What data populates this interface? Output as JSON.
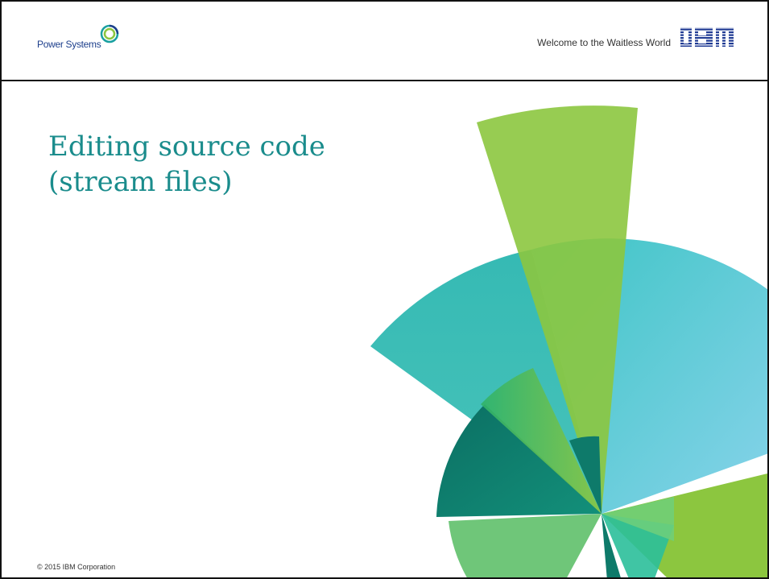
{
  "header": {
    "brand_name": "Power Systems",
    "tagline": "Welcome to the Waitless World",
    "company_logo_icon": "ibm-logo-icon",
    "brand_logo_icon": "power-systems-logo-icon"
  },
  "title": {
    "line1": "Editing source code",
    "line2": "(stream files)"
  },
  "footer": {
    "copyright": "© 2015 IBM Corporation"
  },
  "colors": {
    "title": "#1a8c8c",
    "brand_text": "#1d3f8c",
    "green": "#8cc63f",
    "teal": "#2bbfbf",
    "dark_teal": "#0e7a6a",
    "border": "#111111"
  }
}
